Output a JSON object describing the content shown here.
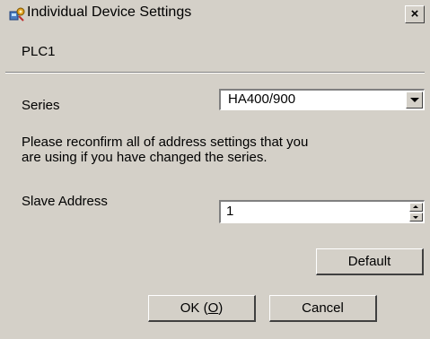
{
  "window": {
    "title": "Individual Device Settings",
    "close_label": "×"
  },
  "device": {
    "name": "PLC1"
  },
  "form": {
    "series_label": "Series",
    "series_value": "HA400/900",
    "note": "Please reconfirm all of address settings that you\nare using if you have changed the series.",
    "slave_address_label": "Slave Address",
    "slave_address_value": "1"
  },
  "buttons": {
    "default_label": "Default",
    "ok_prefix": "OK (",
    "ok_mnemonic": "O",
    "ok_suffix": ")",
    "cancel_label": "Cancel"
  },
  "icons": {
    "title_icon": "device-settings-icon",
    "dropdown": "chevron-down-icon",
    "spin_up": "spin-up-icon",
    "spin_down": "spin-down-icon"
  }
}
